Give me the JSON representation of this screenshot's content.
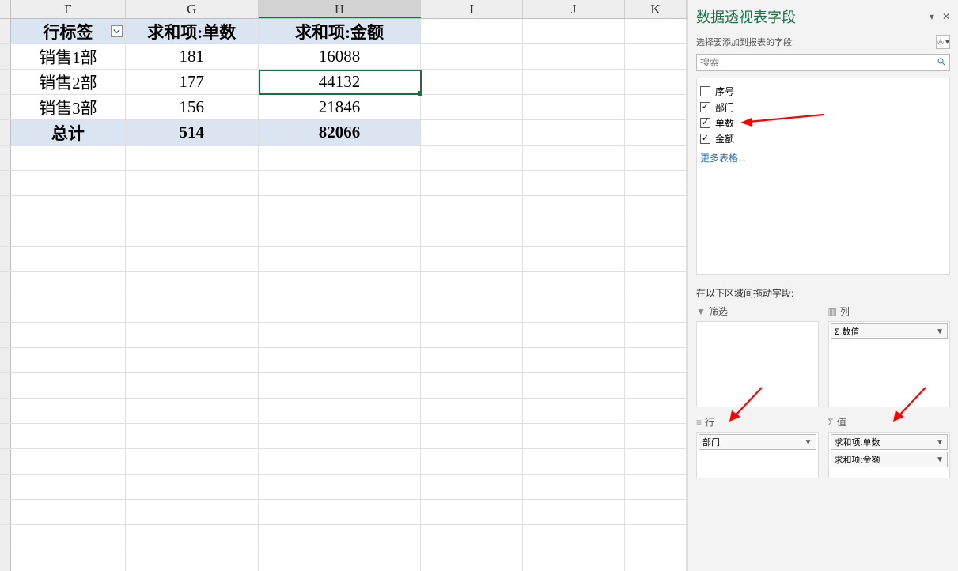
{
  "columns": [
    "F",
    "G",
    "H",
    "I",
    "J",
    "K"
  ],
  "selected_column_index": 2,
  "pivot": {
    "header": {
      "rowlabel": "行标签",
      "sum1": "求和项:单数",
      "sum2": "求和项:金额"
    },
    "rows": [
      {
        "label": "销售1部",
        "v1": "181",
        "v2": "16088"
      },
      {
        "label": "销售2部",
        "v1": "177",
        "v2": "44132"
      },
      {
        "label": "销售3部",
        "v1": "156",
        "v2": "21846"
      }
    ],
    "total": {
      "label": "总计",
      "v1": "514",
      "v2": "82066"
    }
  },
  "selected_cell": {
    "row": 2,
    "col": "H",
    "value": "44132"
  },
  "pane": {
    "title": "数据透视表字段",
    "subtitle": "选择要添加到报表的字段:",
    "search_placeholder": "搜索",
    "fields": [
      {
        "name": "序号",
        "checked": false
      },
      {
        "name": "部门",
        "checked": true
      },
      {
        "name": "单数",
        "checked": true
      },
      {
        "name": "金额",
        "checked": true
      }
    ],
    "more_tables_label": "更多表格...",
    "areas_label": "在以下区域间拖动字段:",
    "areas": {
      "filter": {
        "title": "筛选",
        "items": []
      },
      "columns": {
        "title": "列",
        "items": [
          "Σ 数值"
        ]
      },
      "rows": {
        "title": "行",
        "items": [
          "部门"
        ]
      },
      "values": {
        "title": "值",
        "items": [
          "求和项:单数",
          "求和项:金额"
        ]
      }
    },
    "sigma": "Σ"
  },
  "chart_data": {
    "type": "table",
    "title": "数据透视表",
    "columns": [
      "行标签",
      "求和项:单数",
      "求和项:金额"
    ],
    "rows": [
      [
        "销售1部",
        181,
        16088
      ],
      [
        "销售2部",
        177,
        44132
      ],
      [
        "销售3部",
        156,
        21846
      ],
      [
        "总计",
        514,
        82066
      ]
    ]
  }
}
